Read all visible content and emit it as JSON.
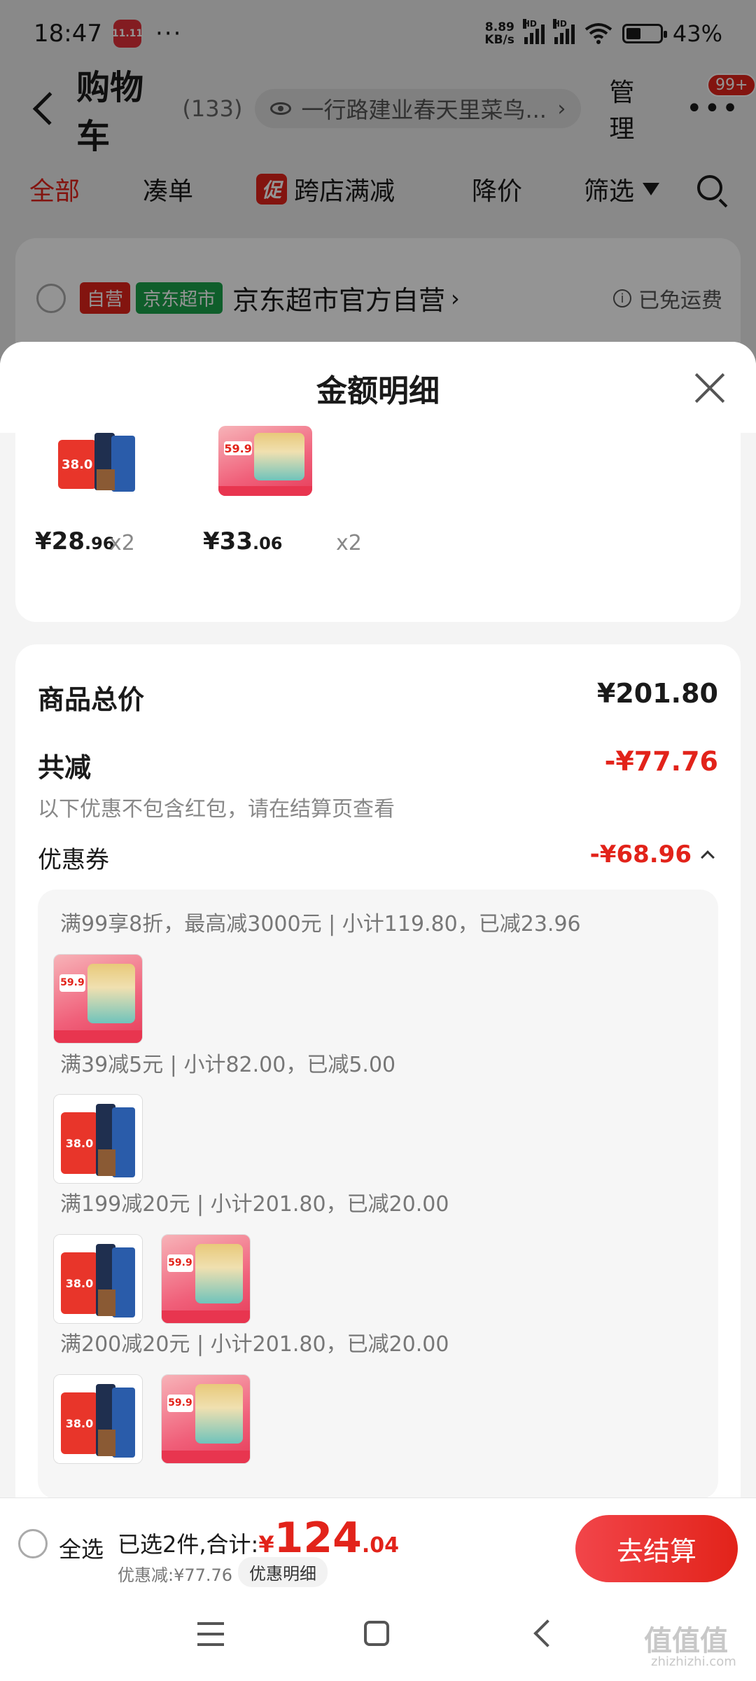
{
  "status_bar": {
    "time": "18:47",
    "app_icon_text": "11.11",
    "dots": "···",
    "net_speed_value": "8.89",
    "net_speed_unit": "KB/s",
    "hd1": "HD",
    "hd2": "HD",
    "battery_level": 0.43,
    "battery_percent": "43%"
  },
  "cart_header": {
    "title": "购物车",
    "count": "(133)",
    "address": "一行路建业春天里菜鸟...",
    "address_arrow": "›",
    "manage": "管理",
    "more_badge": "99+"
  },
  "tabs": {
    "all": "全部",
    "combine": "凑单",
    "promo_tag": "促",
    "cross_store": "跨店满减",
    "price_drop": "降价",
    "filter": "筛选"
  },
  "store": {
    "tag_self": "自营",
    "tag_supermarket": "京东超市",
    "name": "京东超市官方自营",
    "arrow": "›",
    "free_shipping": "已免运费",
    "info_glyph": "i"
  },
  "sheet": {
    "title": "金额明细",
    "products": [
      {
        "kind": "coffee",
        "price_int": "¥28",
        "price_dec": ".96",
        "qty": "x2"
      },
      {
        "kind": "milk",
        "price_int": "¥33",
        "price_dec": ".06",
        "qty": "x2"
      }
    ],
    "total_label": "商品总价",
    "total_value": "¥201.80",
    "reduce_label": "共减",
    "reduce_value": "-¥77.76",
    "note": "以下优惠不包含红包，请在结算页查看",
    "coupon_label": "优惠券",
    "coupon_value": "-¥68.96",
    "coupon_rules": [
      {
        "text": "满99享8折，最高减3000元 | 小计119.80，已减23.96"
      },
      {
        "text": "满39减5元 | 小计82.00，已减5.00"
      },
      {
        "text": "满199减20元 | 小计201.80，已减20.00"
      },
      {
        "text": "满200减20元 | 小计201.80，已减20.00"
      }
    ],
    "art_coffee_price": "38.0",
    "art_milk_price": "59.9"
  },
  "checkout": {
    "select_all": "全选",
    "selected_text": "已选2件,合计:",
    "yen": "¥",
    "total_int": "124",
    "total_dec": ".04",
    "discount_text": "优惠减:¥77.76",
    "detail_button": "优惠明细",
    "checkout_button": "去结算"
  },
  "watermark": {
    "main": "值值值",
    "sub": "zhizhizhi.com"
  }
}
